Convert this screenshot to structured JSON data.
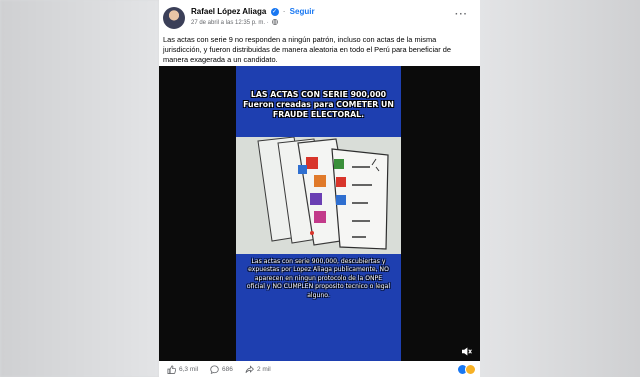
{
  "post": {
    "author": "Rafael López Aliaga",
    "separator": "·",
    "follow_label": "Seguir",
    "timestamp": "27 de abril a las 12:35 p. m.",
    "meta_separator": "·",
    "more_label": "···",
    "text": "Las actas con serie 9 no responden a ningún patrón, incluso con actas de la misma jurisdicción, y fueron distribuidas de manera aleatoria en todo el Perú para beneficiar de manera exagerada a un candidato."
  },
  "video": {
    "title": "LAS ACTAS CON SERIE 900,000 Fueron creadas para COMETER UN FRAUDE ELECTORAL.",
    "caption": "Las actas con serie 900,000, descubiertas y expuestas por Lopez Aliaga publicamente, NO aparecen en ningun protocolo de la ONPE oficial y NO CUMPLEN proposito tecnico o legal alguno.",
    "mute_icon": "speaker-muted-icon"
  },
  "footer": {
    "likes": "6,3 mil",
    "comments": "686",
    "shares": "2 mil"
  },
  "colors": {
    "link_blue": "#1877f2",
    "video_blue": "#1e3fb0"
  }
}
